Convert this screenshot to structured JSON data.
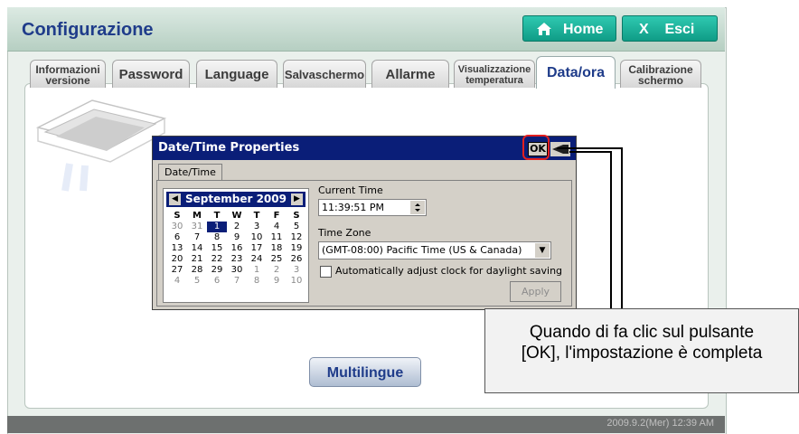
{
  "app": {
    "title": "Configurazione"
  },
  "header": {
    "home_label": "Home",
    "exit_label": "Esci"
  },
  "tabs": [
    {
      "l1": "Informazioni",
      "l2": "versione"
    },
    {
      "label": "Password"
    },
    {
      "label": "Language"
    },
    {
      "label": "Salvaschermo"
    },
    {
      "label": "Allarme"
    },
    {
      "l1": "Visualizzazione",
      "l2": "temperatura"
    },
    {
      "label": "Data/ora",
      "active": true
    },
    {
      "l1": "Calibrazione",
      "l2": "schermo"
    }
  ],
  "dialog": {
    "title": "Date/Time Properties",
    "ok_label": "OK",
    "tab_label": "Date/Time",
    "calendar": {
      "month_label": "September 2009",
      "weekdays": [
        "S",
        "M",
        "T",
        "W",
        "T",
        "F",
        "S"
      ],
      "weeks": [
        [
          "30",
          "31",
          "1",
          "2",
          "3",
          "4",
          "5"
        ],
        [
          "6",
          "7",
          "8",
          "9",
          "10",
          "11",
          "12"
        ],
        [
          "13",
          "14",
          "15",
          "16",
          "17",
          "18",
          "19"
        ],
        [
          "20",
          "21",
          "22",
          "23",
          "24",
          "25",
          "26"
        ],
        [
          "27",
          "28",
          "29",
          "30",
          "1",
          "2",
          "3"
        ],
        [
          "4",
          "5",
          "6",
          "7",
          "8",
          "9",
          "10"
        ]
      ],
      "selected_day": "1"
    },
    "current_time_label": "Current Time",
    "current_time_value": "11:39:51 PM",
    "time_zone_label": "Time Zone",
    "time_zone_value": "(GMT-08:00) Pacific Time (US & Canada)",
    "dst_label": "Automatically adjust clock for daylight saving",
    "dst_checked": false,
    "apply_label": "Apply"
  },
  "multilingue_label": "Multilingue",
  "status": {
    "datetime": "2009.9.2(Mer)  12:39 AM"
  },
  "callout": {
    "line1": "Quando di fa clic sul pulsante",
    "line2": "[OK], l'impostazione è completa"
  }
}
